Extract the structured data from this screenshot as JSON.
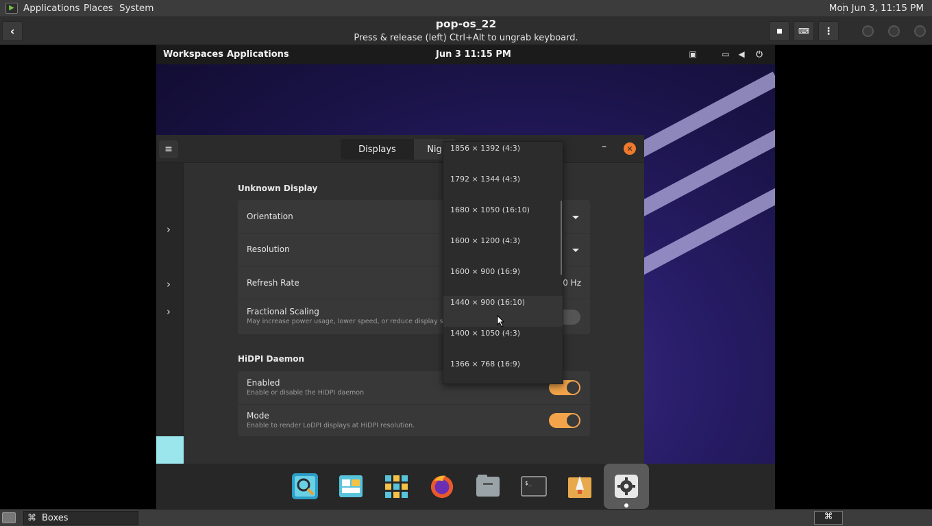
{
  "host_panel": {
    "menus": [
      "Applications",
      "Places",
      "System"
    ],
    "clock": "Mon Jun  3, 11:15 PM"
  },
  "boxes": {
    "title": "pop-os_22",
    "subtitle": "Press & release (left) Ctrl+Alt to ungrab keyboard."
  },
  "guest_panel": {
    "workspaces": "Workspaces",
    "applications": "Applications",
    "clock": "Jun 3   11:15 PM"
  },
  "settings": {
    "tabs": [
      "Displays",
      "Nig"
    ],
    "sections": {
      "display_title": "Unknown Display",
      "hidpi_title": "HiDPI Daemon"
    },
    "rows": {
      "orientation": "Orientation",
      "resolution": "Resolution",
      "refresh_rate": "Refresh Rate",
      "refresh_value": "0 Hz",
      "fractional_scaling": "Fractional Scaling",
      "fractional_desc": "May increase power usage, lower speed, or reduce display sharpness.",
      "enabled": "Enabled",
      "enabled_desc": "Enable or disable the HiDPI daemon",
      "mode": "Mode",
      "mode_desc": "Enable to render LoDPI displays at HiDPI resolution."
    }
  },
  "resolution_options": [
    "1856 × 1392 (4:3)",
    "1792 × 1344 (4:3)",
    "1680 × 1050 (16:10)",
    "1600 × 1200 (4:3)",
    "1600 × 900 (16:9)",
    "1440 × 900 (16:10)",
    "1400 × 1050 (4:3)",
    "1366 × 768 (16:9)"
  ],
  "dock_icons": [
    "search-icon",
    "workspaces-icon",
    "app-grid-icon",
    "firefox-icon",
    "files-icon",
    "terminal-icon",
    "pop-shop-icon",
    "settings-icon"
  ],
  "host_taskbar": {
    "task_label": "Boxes"
  },
  "colors": {
    "accent": "#f3a44a",
    "close": "#f0792b",
    "wallpaper": "#271c66"
  }
}
